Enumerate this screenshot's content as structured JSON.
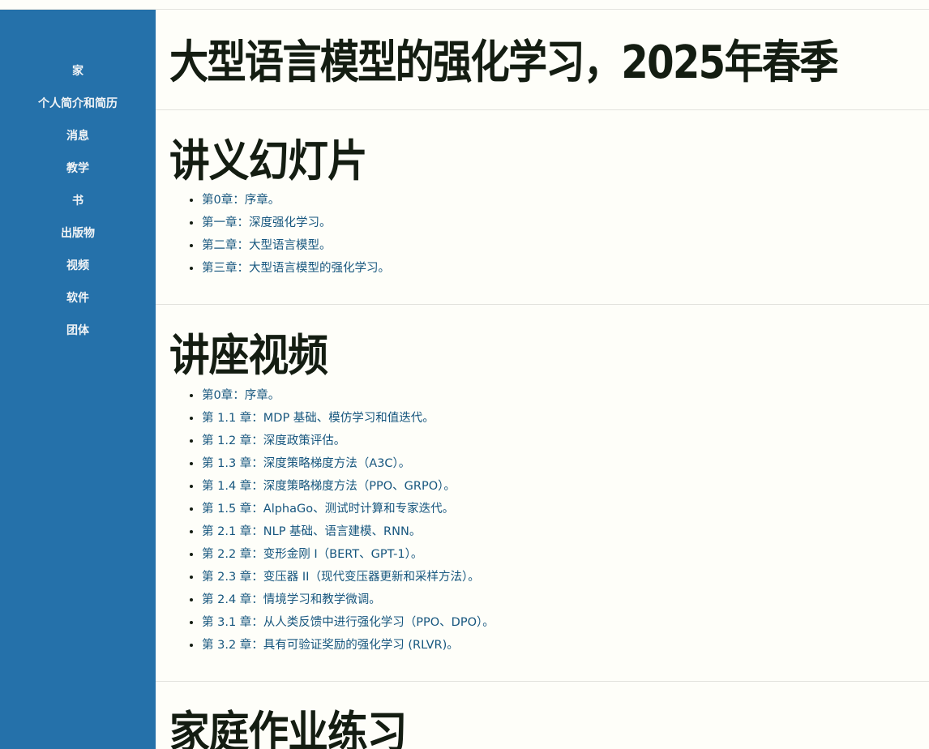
{
  "sidebar": {
    "items": [
      "家",
      "个人简介和简历",
      "消息",
      "教学",
      "书",
      "出版物",
      "视频",
      "软件",
      "团体"
    ]
  },
  "page": {
    "title": "大型语言模型的强化学习，2025年春季"
  },
  "slides": {
    "heading": "讲义幻灯片",
    "items": [
      "第0章：序章。",
      "第一章：深度强化学习。",
      "第二章：大型语言模型。",
      "第三章：大型语言模型的强化学习。"
    ]
  },
  "videos": {
    "heading": "讲座视频",
    "items": [
      "第0章：序章。",
      "第 1.1 章：MDP 基础、模仿学习和值迭代。",
      "第 1.2 章：深度政策评估。",
      "第 1.3 章：深度策略梯度方法（A3C）。",
      "第 1.4 章：深度策略梯度方法（PPO、GRPO）。",
      "第 1.5 章：AlphaGo、测试时计算和专家迭代。",
      "第 2.1 章：NLP 基础、语言建模、RNN。",
      "第 2.2 章：变形金刚 I（BERT、GPT-1）。",
      "第 2.3 章：变压器 II（现代变压器更新和采样方法）。",
      "第 2.4 章：情境学习和教学微调。",
      "第 3.1 章：从人类反馈中进行强化学习（PPO、DPO）。",
      "第 3.2 章：具有可验证奖励的强化学习 (RLVR)。"
    ]
  },
  "homework": {
    "heading": "家庭作业练习"
  },
  "colors": {
    "sidebar": "#2571aa",
    "link": "#16567e",
    "background": "#fefef9"
  }
}
